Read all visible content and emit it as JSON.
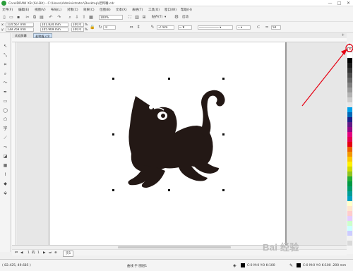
{
  "window": {
    "title": "CorelDRAW X8 (64-Bit) - C:\\Users\\Administrator\\Desktop\\老鸭嘴.cdr",
    "controls": [
      "—",
      "□",
      "✕"
    ]
  },
  "menu": [
    "文件(F)",
    "编辑(E)",
    "视图(V)",
    "布局(L)",
    "对象(C)",
    "效果(C)",
    "位图(B)",
    "文本(X)",
    "表格(T)",
    "工具(O)",
    "窗口(W)",
    "帮助(H)"
  ],
  "toolbar": {
    "zoom": "100%",
    "snap_label": "贴齐(T)",
    "snap_arrow": "▾",
    "settings_icon": "gear-icon",
    "launch_label": "启动"
  },
  "properties": {
    "x": "114.567 mm",
    "y": "139.769 mm",
    "width": "101.824 mm",
    "height": "105.909 mm",
    "scale_w": "100.0",
    "scale_h": "100.0",
    "percent": "%",
    "rotation": ".0",
    "outline_width": ".2 mm",
    "smoothing": "50"
  },
  "tabs": [
    "欢迎屏幕",
    "老鸭嘴.cdr"
  ],
  "page_nav": {
    "current": "1",
    "of_label": "的",
    "total": "1",
    "page_tab": "页1"
  },
  "status": {
    "coords": "( 82.425, 49.685 )",
    "object_info": "曲线 于 图层1",
    "fill_info": "C:0 M:0 Y:0 K:100",
    "outline_info": "C:0 M:0 Y:0 K:100  .200 mm"
  },
  "palette_colors": [
    "#ffffff",
    "#000000",
    "#1a1a1a",
    "#333333",
    "#4d4d4d",
    "#666666",
    "#808080",
    "#999999",
    "#b3b3b3",
    "#cccccc",
    "#e6e6e6",
    "#00a0e9",
    "#0068b7",
    "#1d2088",
    "#601986",
    "#920783",
    "#e4007f",
    "#e5004f",
    "#e60012",
    "#eb6100",
    "#f39800",
    "#fcc800",
    "#fff100",
    "#cfdb00",
    "#8fc31f",
    "#22ac38",
    "#009944",
    "#009b6b",
    "#009e96",
    "#00a0c1",
    "#ffffcc",
    "#ffe5cc",
    "#ffcccc",
    "#e5ccff",
    "#ccffcc",
    "#ccffff",
    "#ccccff",
    "#f2f2f2",
    "#d9d9d9"
  ],
  "watermark": "Bai 经验",
  "accent": "#e60012"
}
